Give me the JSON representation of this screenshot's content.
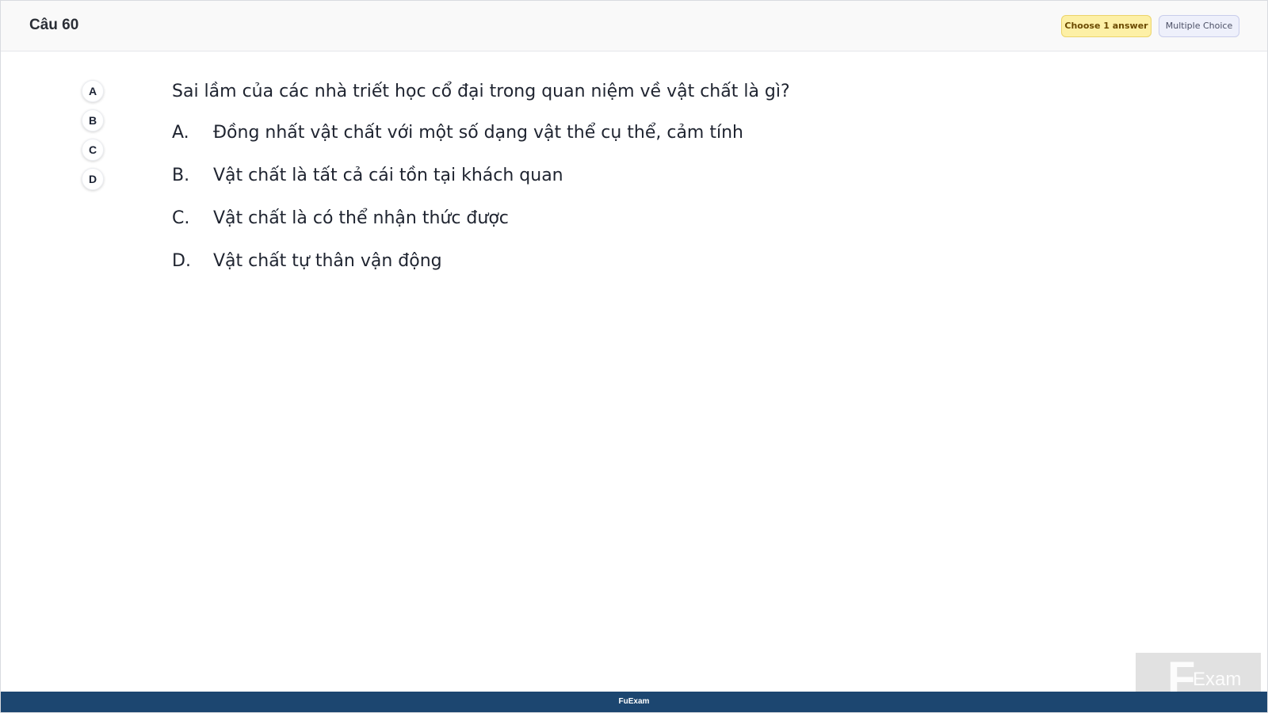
{
  "header": {
    "question_number": "Câu 60",
    "badge_choose": "Choose 1 answer",
    "badge_type": "Multiple Choice"
  },
  "picker": {
    "options": [
      "A",
      "B",
      "C",
      "D"
    ]
  },
  "question": {
    "text": "Sai lầm của các nhà triết học cổ đại trong quan niệm về vật chất là gì?",
    "options": [
      {
        "letter": "A.",
        "text": "Đồng nhất vật chất với một số dạng vật thể cụ thể, cảm tính"
      },
      {
        "letter": "B.",
        "text": "Vật chất là tất cả cái tồn tại khách quan"
      },
      {
        "letter": "C.",
        "text": "Vật chất là có thể nhận thức được"
      },
      {
        "letter": "D.",
        "text": "Vật chất tự thân vận động"
      }
    ]
  },
  "footer": {
    "text": "FuExam"
  },
  "watermark": {
    "f_text": "F",
    "exam_text": "Exam"
  },
  "colors": {
    "footer_bg": "#1c4670",
    "badge_choose_bg": "#fdf0a6",
    "badge_type_bg": "#eef0fb"
  }
}
